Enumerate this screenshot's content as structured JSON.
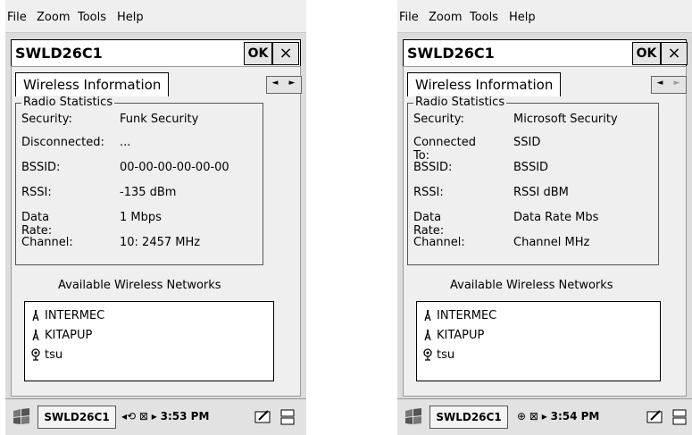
{
  "menus": [
    "File",
    "Zoom",
    "Tools",
    "Help"
  ],
  "left": {
    "title": "SWLD26C1",
    "ok": "OK",
    "close": "×",
    "tab": "Wireless Information",
    "group_title": "Radio Statistics",
    "stats": [
      {
        "label": "Security:",
        "value": "Funk Security"
      },
      {
        "label": "Disconnected:",
        "value": "..."
      },
      {
        "label": "BSSID:",
        "value": "00-00-00-00-00-00"
      },
      {
        "label": "RSSI:",
        "value": "-135 dBm"
      },
      {
        "label": "Data Rate:",
        "value": "1 Mbps"
      },
      {
        "label": "Channel:",
        "value": "10: 2457 MHz"
      }
    ],
    "networks_title": "Available Wireless Networks",
    "networks": [
      "INTERMEC",
      "KITAPUP",
      "tsu"
    ],
    "taskbar_app": "SWLD26C1",
    "time": "3:53 PM"
  },
  "right": {
    "title": "SWLD26C1",
    "ok": "OK",
    "close": "×",
    "tab": "Wireless Information",
    "group_title": "Radio Statistics",
    "stats": [
      {
        "label": "Security:",
        "value": "Microsoft Security"
      },
      {
        "label": "Connected To:",
        "value": "SSID"
      },
      {
        "label": "BSSID:",
        "value": "BSSID"
      },
      {
        "label": "RSSI:",
        "value": "RSSI dBM"
      },
      {
        "label": "Data Rate:",
        "value": "Data Rate Mbs"
      },
      {
        "label": "Channel:",
        "value": "Channel MHz"
      }
    ],
    "networks_title": "Available Wireless Networks",
    "networks": [
      "INTERMEC",
      "KITAPUP",
      "tsu"
    ],
    "taskbar_app": "SWLD26C1",
    "time": "3:54 PM"
  },
  "icons": {
    "network_antenna": "antenna-icon",
    "network_adhoc": "adhoc-network-icon",
    "arrow_left": "◄",
    "arrow_right": "►",
    "tray_arrow": "▸"
  }
}
